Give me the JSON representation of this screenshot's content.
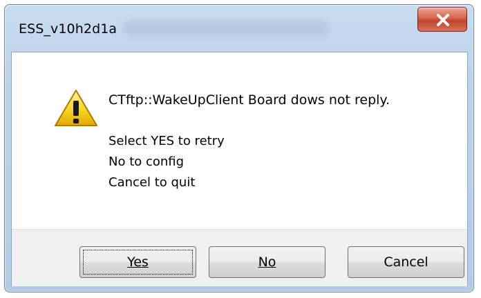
{
  "window": {
    "title": "ESS_v10h2d1a",
    "close_label": "x"
  },
  "message": {
    "icon": "warning-icon",
    "main": "CTftp::WakeUpClient Board dows not reply.",
    "line1": "Select YES to retry",
    "line2": "No to config",
    "line3": "Cancel to quit"
  },
  "buttons": {
    "yes_label": "Yes",
    "no_label": "No",
    "cancel_label": "Cancel"
  },
  "colors": {
    "title_bar": "#bcd2ea",
    "close_button": "#c2432e",
    "button_area": "#f0f0f0"
  }
}
